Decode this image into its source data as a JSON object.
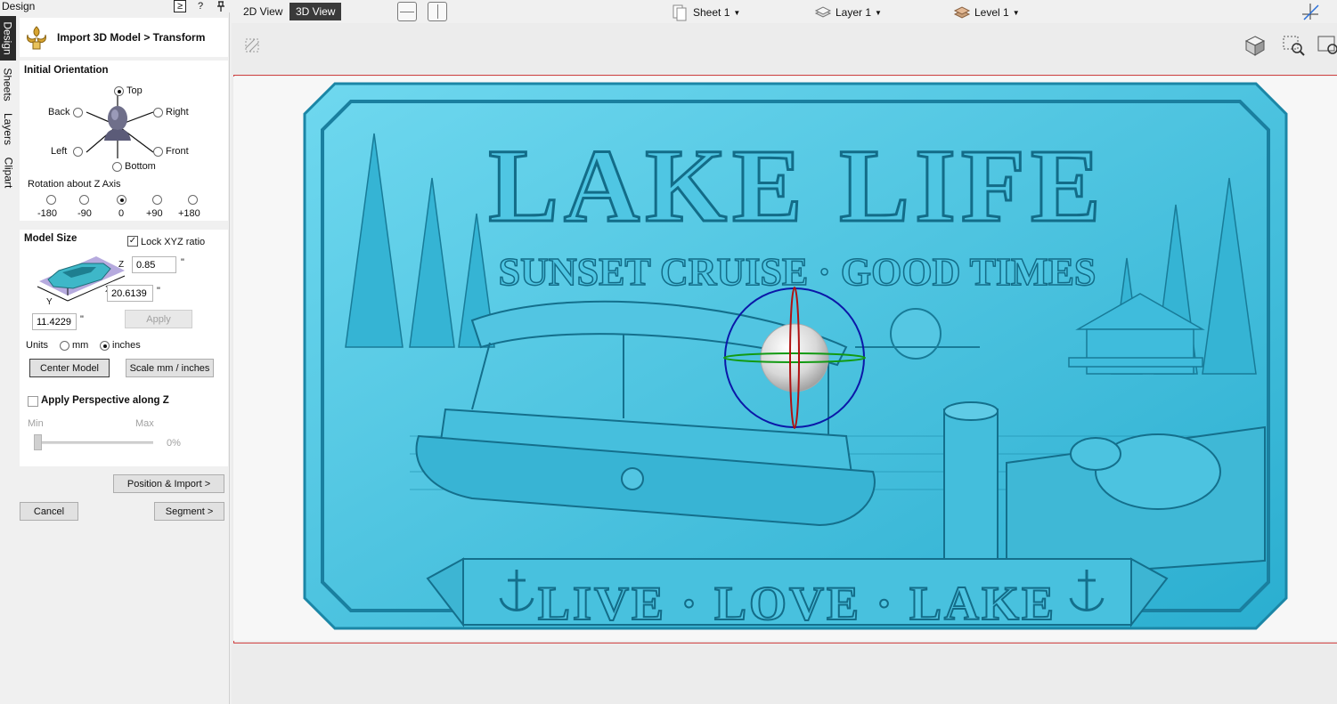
{
  "panel_window": {
    "title": "Design"
  },
  "side_tabs": [
    "Design",
    "Sheets",
    "Layers",
    "Clipart"
  ],
  "header": {
    "title": "Import 3D Model > Transform"
  },
  "orientation": {
    "title": "Initial Orientation",
    "options": {
      "top": "Top",
      "back": "Back",
      "right": "Right",
      "left": "Left",
      "front": "Front",
      "bottom": "Bottom"
    },
    "selected": "Top",
    "rotation_label": "Rotation about Z Axis",
    "rotations": [
      "-180",
      "-90",
      "0",
      "+90",
      "+180"
    ],
    "rotation_selected": "0"
  },
  "model_size": {
    "title": "Model Size",
    "lock_label": "Lock XYZ ratio",
    "lock_checked": true,
    "z_label": "Z",
    "z_value": "0.85",
    "x_label": "X",
    "x_value": "20.6139",
    "y_label": "Y",
    "y_value": "11.4229",
    "unit_mark": "\"",
    "apply_label": "Apply",
    "units_label": "Units",
    "unit_mm": "mm",
    "unit_inches": "inches",
    "units_selected": "inches",
    "center_model_label": "Center Model",
    "scale_label": "Scale mm / inches"
  },
  "perspective": {
    "title": "Apply Perspective along Z",
    "checked": false,
    "min_label": "Min",
    "max_label": "Max",
    "value": "0%"
  },
  "footer": {
    "position_import_label": "Position & Import >",
    "cancel_label": "Cancel",
    "segment_label": "Segment >"
  },
  "toolbar": {
    "view_2d": "2D View",
    "view_3d": "3D View",
    "active_view": "3D View",
    "sheet": "Sheet 1",
    "layer": "Layer 1",
    "level": "Level 1"
  },
  "relief": {
    "title": "LAKE LIFE",
    "subtitle": "SUNSET CRUISE · GOOD TIMES",
    "banner": "LIVE · LOVE · LAKE",
    "color": "#4cc9e6"
  },
  "colors": {
    "accent": "#2b2b2b",
    "relief": "#4cc9e6",
    "gizmo_ring": "#0b18a8",
    "gizmo_x": "#b01010",
    "gizmo_y": "#129a12"
  }
}
